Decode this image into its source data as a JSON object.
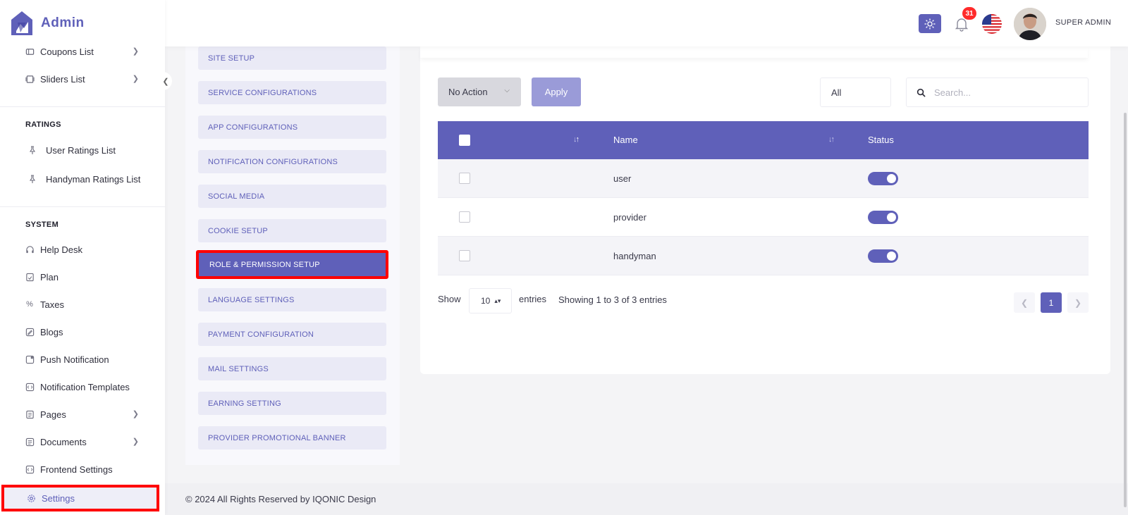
{
  "app": {
    "brand": "Admin"
  },
  "sidebar": {
    "top_items": [
      {
        "label": "Coupons List",
        "icon": "coupon-icon"
      },
      {
        "label": "Sliders List",
        "icon": "slider-icon"
      }
    ],
    "ratings_heading": "RATINGS",
    "ratings_items": [
      {
        "label": "User Ratings List",
        "icon": "pin-icon"
      },
      {
        "label": "Handyman Ratings List",
        "icon": "pin-icon"
      }
    ],
    "system_heading": "SYSTEM",
    "system_items": [
      {
        "label": "Help Desk",
        "icon": "headset-icon"
      },
      {
        "label": "Plan",
        "icon": "plan-icon"
      },
      {
        "label": "Taxes",
        "icon": "percent-icon"
      },
      {
        "label": "Blogs",
        "icon": "blog-icon"
      },
      {
        "label": "Push Notification",
        "icon": "push-icon"
      },
      {
        "label": "Notification Templates",
        "icon": "template-icon"
      },
      {
        "label": "Pages",
        "icon": "pages-icon"
      },
      {
        "label": "Documents",
        "icon": "document-icon"
      },
      {
        "label": "Frontend Settings",
        "icon": "frontend-icon"
      },
      {
        "label": "Settings",
        "icon": "gear-icon"
      }
    ]
  },
  "header": {
    "notification_count": "31",
    "user_name": "SUPER ADMIN"
  },
  "settings_menu": [
    "SITE SETUP",
    "SERVICE CONFIGURATIONS",
    "APP CONFIGURATIONS",
    "NOTIFICATION CONFIGURATIONS",
    "SOCIAL MEDIA",
    "COOKIE SETUP",
    "ROLE & PERMISSION SETUP",
    "LANGUAGE SETTINGS",
    "PAYMENT CONFIGURATION",
    "MAIL SETTINGS",
    "EARNING SETTING",
    "PROVIDER PROMOTIONAL BANNER"
  ],
  "settings_active": "ROLE & PERMISSION SETUP",
  "toolbar": {
    "bulk_action": "No Action",
    "apply": "Apply",
    "filter": "All",
    "search_placeholder": "Search..."
  },
  "table": {
    "headers": {
      "name": "Name",
      "status": "Status"
    },
    "rows": [
      {
        "name": "user",
        "status": true
      },
      {
        "name": "provider",
        "status": true
      },
      {
        "name": "handyman",
        "status": true
      }
    ]
  },
  "pagination": {
    "show_label": "Show",
    "page_size": "10",
    "entries_label": "entries",
    "info": "Showing 1 to 3 of 3 entries",
    "current_page": "1"
  },
  "footer": {
    "text": "© 2024 All Rights Reserved by IQONIC Design"
  },
  "colors": {
    "accent": "#5f60b9",
    "highlight": "#ff0000",
    "badge": "#ff2b2b"
  }
}
